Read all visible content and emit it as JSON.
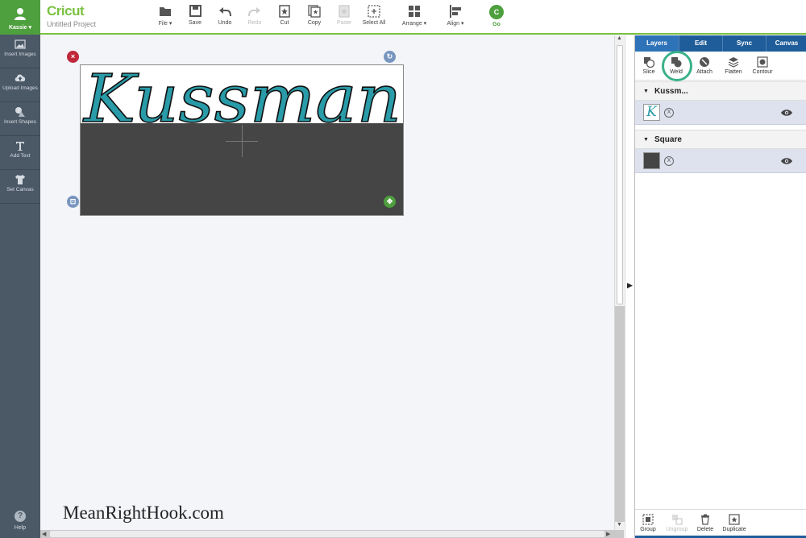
{
  "user": {
    "name": "Kassie ▾"
  },
  "brand": {
    "logo": "Cricut",
    "project_title": "Untitled Project"
  },
  "toolbar": [
    {
      "label": "File ▾",
      "icon": "folder-icon"
    },
    {
      "label": "Save",
      "icon": "save-icon"
    },
    {
      "label": "Undo",
      "icon": "undo-icon"
    },
    {
      "label": "Redo",
      "icon": "redo-icon",
      "disabled": true
    },
    {
      "label": "Cut",
      "icon": "cut-icon"
    },
    {
      "label": "Copy",
      "icon": "copy-icon"
    },
    {
      "label": "Paste",
      "icon": "paste-icon",
      "disabled": true
    },
    {
      "label": "Select All",
      "icon": "select-all-icon"
    },
    {
      "label": "Arrange ▾",
      "icon": "arrange-icon"
    },
    {
      "label": "Align ▾",
      "icon": "align-icon"
    }
  ],
  "go": {
    "label": "Go",
    "badge": "C"
  },
  "sidebar": [
    {
      "label": "Insert Images",
      "icon": "image-icon"
    },
    {
      "label": "Upload Images",
      "icon": "cloud-upload-icon"
    },
    {
      "label": "Insert Shapes",
      "icon": "shapes-icon"
    },
    {
      "label": "Add Text",
      "icon": "text-icon"
    },
    {
      "label": "Set Canvas",
      "icon": "shirt-icon"
    }
  ],
  "help": {
    "label": "Help",
    "icon_text": "?"
  },
  "canvas": {
    "design_text": "Kussman",
    "watermark": "MeanRightHook.com"
  },
  "colors": {
    "text_fill": "#2a9ba8",
    "square_fill": "#454545",
    "accent_green": "#7bc142",
    "highlight": "#3bb18a",
    "panel_blue": "#1f5d9a"
  },
  "panel": {
    "tabs": [
      "Layers",
      "Edit",
      "Sync",
      "Canvas"
    ],
    "active_tab": "Layers",
    "operations": [
      {
        "label": "Slice",
        "icon": "slice-icon"
      },
      {
        "label": "Weld",
        "icon": "weld-icon"
      },
      {
        "label": "Attach",
        "icon": "attach-icon"
      },
      {
        "label": "Flatten",
        "icon": "flatten-icon"
      },
      {
        "label": "Contour",
        "icon": "contour-icon"
      }
    ],
    "layer_groups": [
      {
        "name": "Kussm...",
        "thumb_letter": "K"
      },
      {
        "name": "Square"
      }
    ],
    "footer": [
      {
        "label": "Group",
        "icon": "group-icon"
      },
      {
        "label": "Ungroup",
        "icon": "ungroup-icon",
        "disabled": true
      },
      {
        "label": "Delete",
        "icon": "trash-icon"
      },
      {
        "label": "Duplicate",
        "icon": "duplicate-icon"
      }
    ]
  }
}
